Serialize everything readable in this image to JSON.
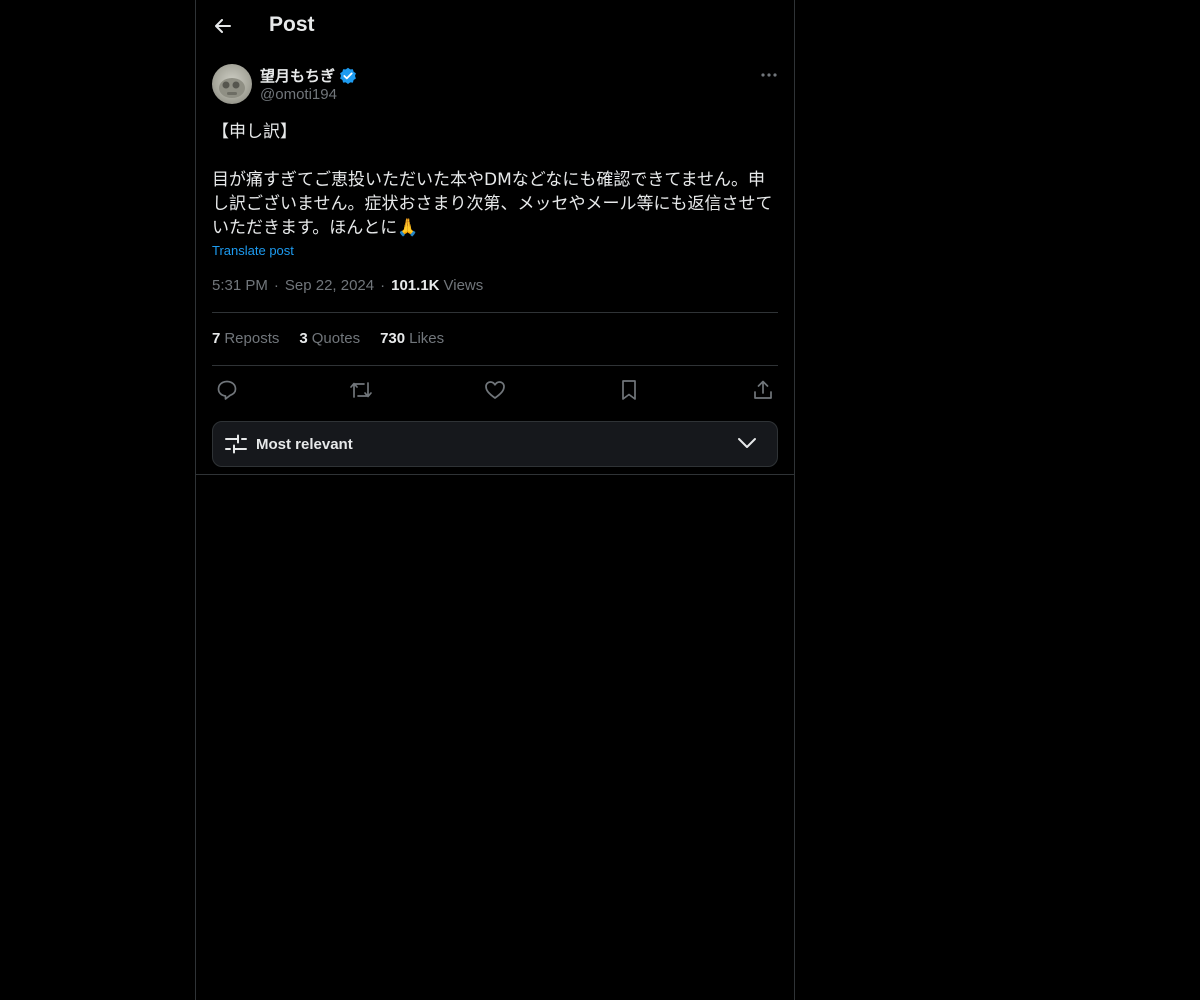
{
  "header": {
    "title": "Post",
    "back_icon": "arrow-left-icon"
  },
  "author": {
    "display_name": "望月もちぎ",
    "handle": "@omoti194",
    "verified": true,
    "verified_color": "#1d9bf0"
  },
  "post": {
    "text": "【申し訳】\n\n目が痛すぎてご恵投いただいた本やDMなどなにも確認できてません。申し訳ございません。症状おさまり次第、メッセやメール等にも返信させていただきます。ほんとに🙏",
    "translate_label": "Translate post",
    "time": "5:31 PM",
    "date": "Sep 22, 2024",
    "views_count": "101.1K",
    "views_label": "Views"
  },
  "stats": {
    "reposts_count": "7",
    "reposts_label": "Reposts",
    "quotes_count": "3",
    "quotes_label": "Quotes",
    "likes_count": "730",
    "likes_label": "Likes"
  },
  "actions": [
    "reply-icon",
    "repost-icon",
    "like-icon",
    "bookmark-icon",
    "share-icon"
  ],
  "sort": {
    "label": "Most relevant"
  },
  "colors": {
    "background": "#000000",
    "text": "#e7e9ea",
    "muted": "#71767b",
    "accent": "#1d9bf0",
    "border": "#2f3336"
  }
}
